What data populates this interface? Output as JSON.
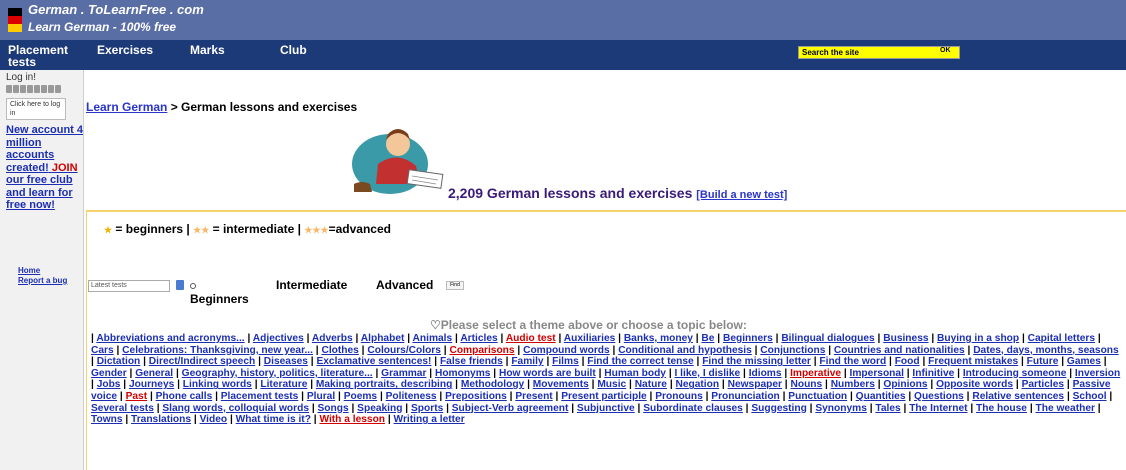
{
  "header": {
    "logo_line1": "German . ToLearnFree . com",
    "logo_line2": "Learn German - 100% free"
  },
  "nav": {
    "placement": "Placement tests",
    "exercises": "Exercises",
    "marks": "Marks",
    "club": "Club",
    "search_placeholder": "Search the site",
    "search_button": "OK"
  },
  "sidebar": {
    "login_title": "Log in!",
    "login_button": "Click here to log in",
    "promo_pre": "New account 4 million accounts created!",
    "promo_red": "JOIN",
    "promo_post": "our free club and learn for free now!",
    "links": [
      "Home",
      "Report a bug"
    ]
  },
  "main": {
    "breadcrumb_link": "Learn German",
    "breadcrumb_rest": " > German lessons and exercises",
    "headline": "2,209 German lessons and exercises",
    "build_test": "[Build a new test]",
    "legend_beginners": " = beginners |",
    "legend_intermediate": " = intermediate |",
    "legend_advanced": "=advanced",
    "filter_select": "Latest tests",
    "filter_beginners": "Beginners",
    "filter_intermediate": "Intermediate",
    "filter_advanced": "Advanced",
    "filter_go": "Find",
    "select_message": "Please select a theme above or choose a topic below:"
  },
  "topics": [
    {
      "t": "Abbreviations and acronyms..."
    },
    {
      "t": "Adjectives"
    },
    {
      "t": "Adverbs"
    },
    {
      "t": "Alphabet"
    },
    {
      "t": "Animals"
    },
    {
      "t": "Articles"
    },
    {
      "t": "Audio test",
      "red": true
    },
    {
      "t": "Auxiliaries"
    },
    {
      "t": "Banks, money"
    },
    {
      "t": "Be"
    },
    {
      "t": "Beginners"
    },
    {
      "t": "Bilingual dialogues"
    },
    {
      "t": "Business"
    },
    {
      "t": "Buying in a shop"
    },
    {
      "t": "Capital letters"
    },
    {
      "t": "Cars"
    },
    {
      "t": "Celebrations: Thanksgiving, new year..."
    },
    {
      "t": "Clothes"
    },
    {
      "t": "Colours/Colors"
    },
    {
      "t": "Comparisons",
      "red": true
    },
    {
      "t": "Compound words"
    },
    {
      "t": "Conditional and hypothesis"
    },
    {
      "t": "Conjunctions"
    },
    {
      "t": "Countries and nationalities"
    },
    {
      "t": "Dates, days, months, seasons"
    },
    {
      "t": "Dictation"
    },
    {
      "t": "Direct/Indirect speech"
    },
    {
      "t": "Diseases"
    },
    {
      "t": "Exclamative sentences!"
    },
    {
      "t": "False friends"
    },
    {
      "t": "Family"
    },
    {
      "t": "Films"
    },
    {
      "t": "Find the correct tense"
    },
    {
      "t": "Find the missing letter"
    },
    {
      "t": "Find the word"
    },
    {
      "t": "Food"
    },
    {
      "t": "Frequent mistakes"
    },
    {
      "t": "Future"
    },
    {
      "t": "Games"
    },
    {
      "t": "Gender"
    },
    {
      "t": "General"
    },
    {
      "t": "Geography, history, politics, literature..."
    },
    {
      "t": "Grammar"
    },
    {
      "t": "Homonyms"
    },
    {
      "t": "How words are built"
    },
    {
      "t": "Human body"
    },
    {
      "t": "I like, I dislike"
    },
    {
      "t": "Idioms"
    },
    {
      "t": "Imperative",
      "red": true
    },
    {
      "t": "Impersonal"
    },
    {
      "t": "Infinitive"
    },
    {
      "t": "Introducing someone"
    },
    {
      "t": "Inversion"
    },
    {
      "t": "Jobs"
    },
    {
      "t": "Journeys"
    },
    {
      "t": "Linking words"
    },
    {
      "t": "Literature"
    },
    {
      "t": "Making portraits, describing"
    },
    {
      "t": "Methodology"
    },
    {
      "t": "Movements"
    },
    {
      "t": "Music"
    },
    {
      "t": "Nature"
    },
    {
      "t": "Negation"
    },
    {
      "t": "Newspaper"
    },
    {
      "t": "Nouns"
    },
    {
      "t": "Numbers"
    },
    {
      "t": "Opinions"
    },
    {
      "t": "Opposite words"
    },
    {
      "t": "Particles"
    },
    {
      "t": "Passive voice"
    },
    {
      "t": "Past",
      "red": true
    },
    {
      "t": "Phone calls"
    },
    {
      "t": "Placement tests"
    },
    {
      "t": "Plural"
    },
    {
      "t": "Poems"
    },
    {
      "t": "Politeness"
    },
    {
      "t": "Prepositions"
    },
    {
      "t": "Present"
    },
    {
      "t": "Present participle"
    },
    {
      "t": "Pronouns"
    },
    {
      "t": "Pronunciation"
    },
    {
      "t": "Punctuation"
    },
    {
      "t": "Quantities"
    },
    {
      "t": "Questions"
    },
    {
      "t": "Relative sentences"
    },
    {
      "t": "School"
    },
    {
      "t": "Several tests"
    },
    {
      "t": "Slang words, colloquial words"
    },
    {
      "t": "Songs"
    },
    {
      "t": "Speaking"
    },
    {
      "t": "Sports"
    },
    {
      "t": "Subject-Verb agreement"
    },
    {
      "t": "Subjunctive"
    },
    {
      "t": "Subordinate clauses"
    },
    {
      "t": "Suggesting"
    },
    {
      "t": "Synonyms"
    },
    {
      "t": "Tales"
    },
    {
      "t": "The Internet"
    },
    {
      "t": "The house"
    },
    {
      "t": "The weather"
    },
    {
      "t": "Towns"
    },
    {
      "t": "Translations"
    },
    {
      "t": "Video"
    },
    {
      "t": "What time is it?"
    },
    {
      "t": "With a lesson",
      "red": true
    },
    {
      "t": "Writing a letter"
    }
  ],
  "colors": {
    "header": "#5a6ea6",
    "navbar": "#1d3a78",
    "link": "#1c2fb3",
    "red_link": "#d10000",
    "search": "#ffff00",
    "panel_border": "#f5d36a"
  }
}
